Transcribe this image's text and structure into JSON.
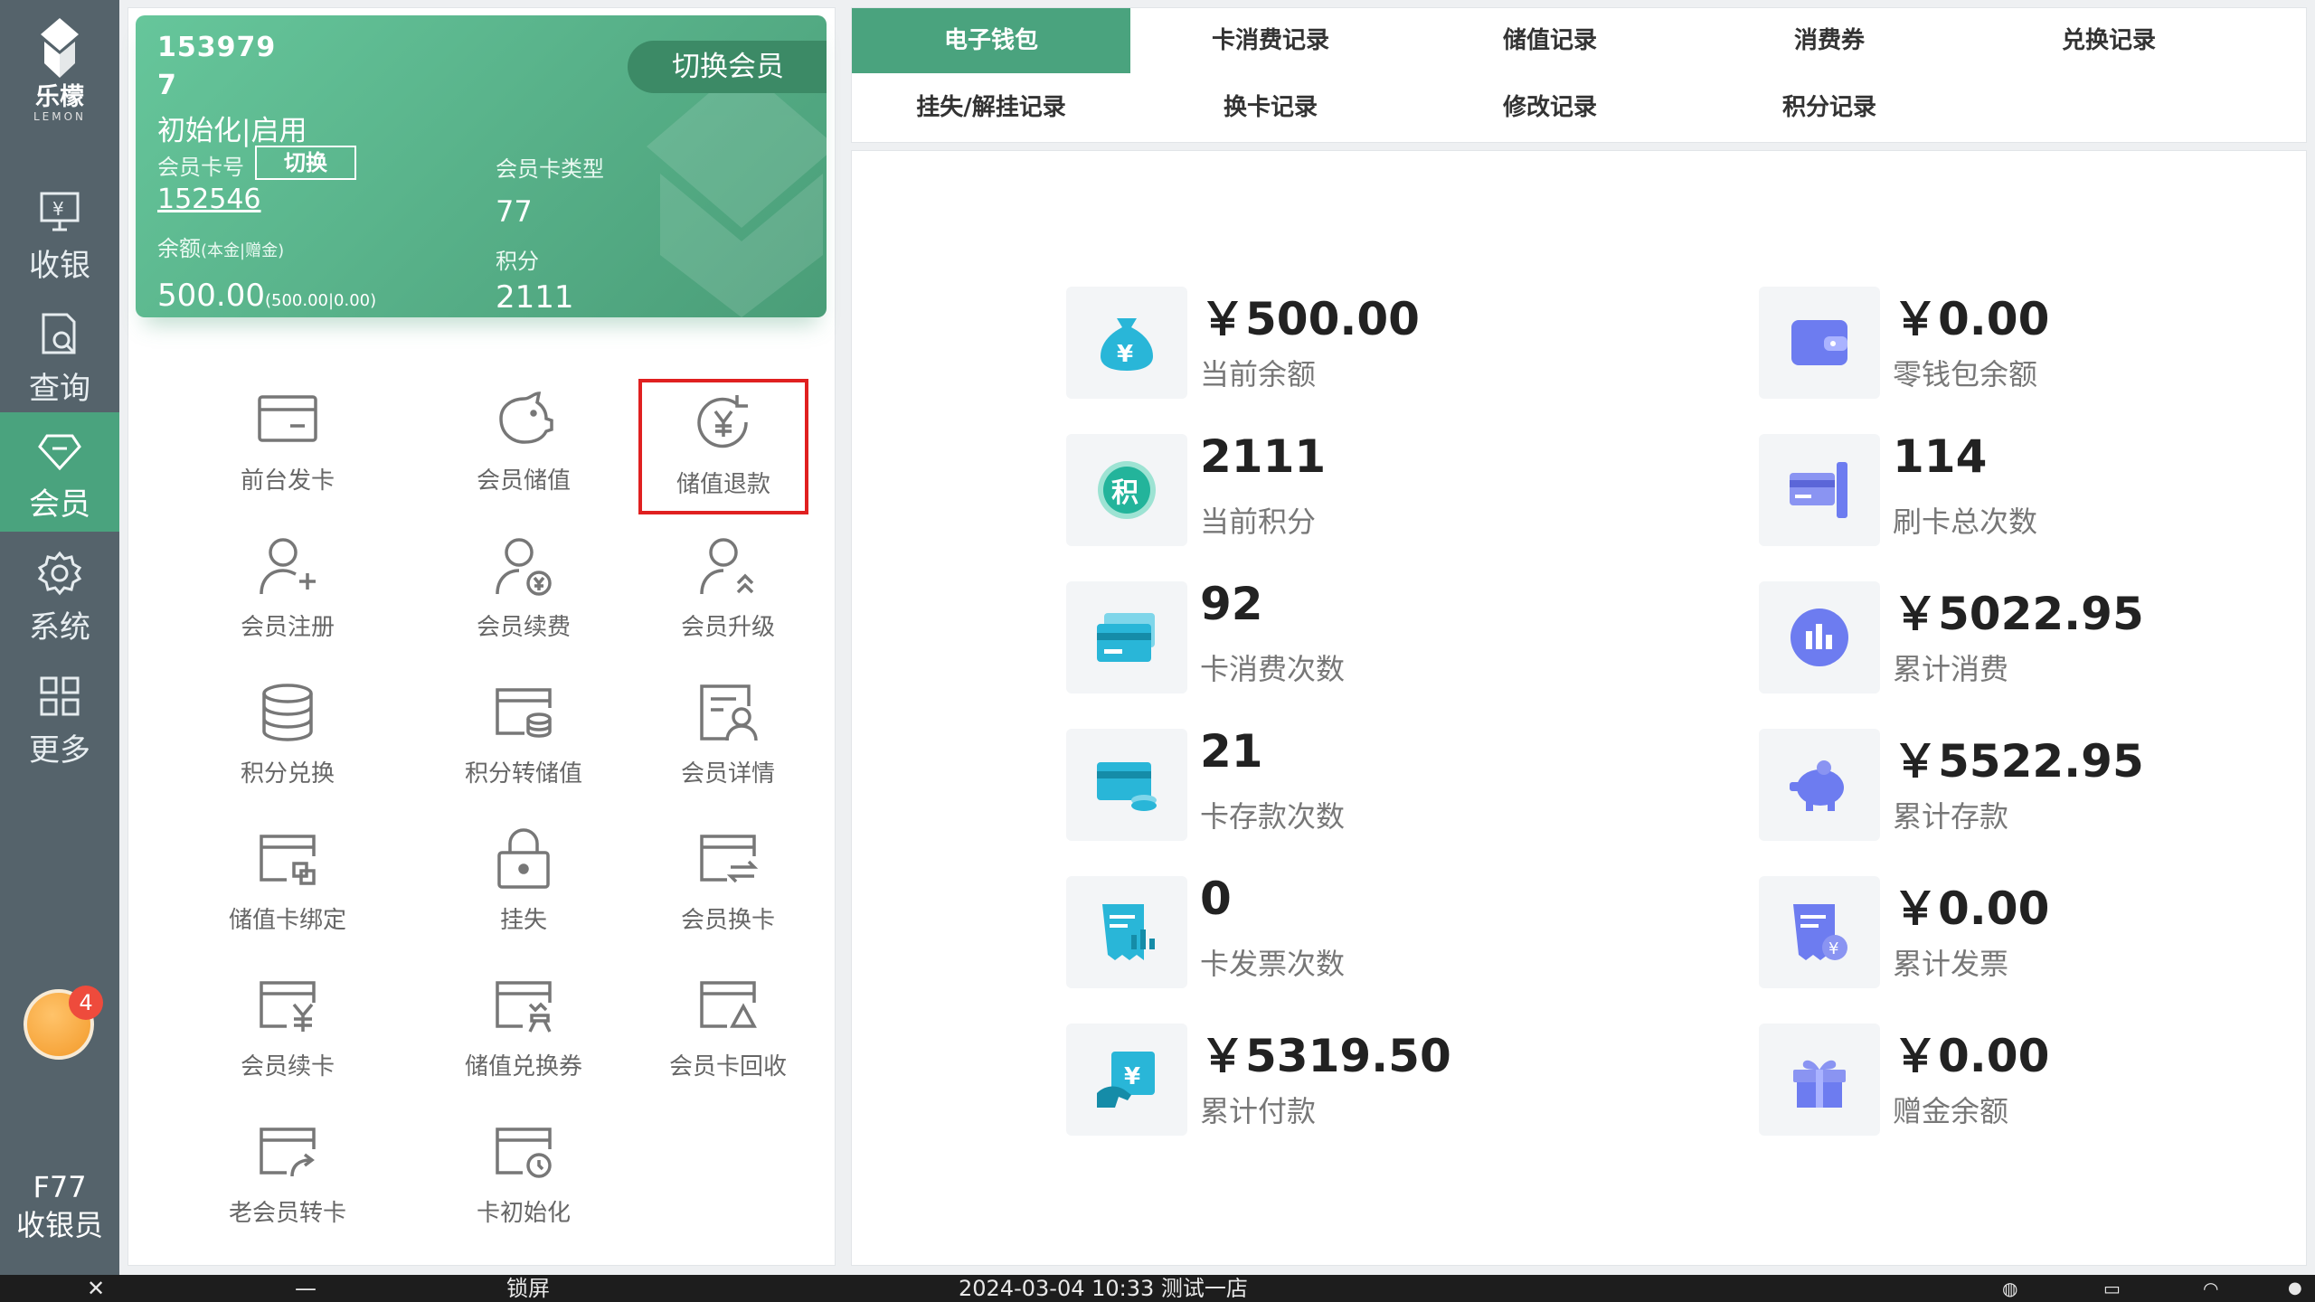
{
  "brand": {
    "name_cn": "乐檬",
    "name_en": "LEMON"
  },
  "nav": {
    "items": [
      {
        "label": "收银",
        "icon": "cashier-icon"
      },
      {
        "label": "查询",
        "icon": "query-icon"
      },
      {
        "label": "会员",
        "icon": "member-diamond-icon",
        "active": true
      },
      {
        "label": "系统",
        "icon": "settings-gear-icon"
      },
      {
        "label": "更多",
        "icon": "grid-more-icon"
      }
    ],
    "notification_count": "4",
    "cashier_code": "F77",
    "cashier_role": "收银员"
  },
  "member_card": {
    "phone_line1": "153979",
    "phone_line2": "7",
    "status": "初始化|启用",
    "card_no_label": "会员卡号",
    "switch_label": "切换",
    "card_no": "152546",
    "balance_label": "余额",
    "balance_label_note": "(本金|赠金)",
    "balance": "500.00",
    "balance_note": "(500.00|0.00)",
    "card_type_label": "会员卡类型",
    "card_type": "77",
    "points_label": "积分",
    "points": "2111",
    "switch_member_label": "切换会员"
  },
  "functions": [
    {
      "label": "前台发卡",
      "icon": "card-icon"
    },
    {
      "label": "会员储值",
      "icon": "piggy-bank-icon"
    },
    {
      "label": "储值退款",
      "icon": "yuan-refund-icon",
      "highlighted": true
    },
    {
      "label": "会员注册",
      "icon": "user-add-icon"
    },
    {
      "label": "会员续费",
      "icon": "user-yuan-icon"
    },
    {
      "label": "会员升级",
      "icon": "user-upgrade-icon"
    },
    {
      "label": "积分兑换",
      "icon": "database-icon"
    },
    {
      "label": "积分转储值",
      "icon": "card-coins-icon"
    },
    {
      "label": "会员详情",
      "icon": "user-detail-icon"
    },
    {
      "label": "储值卡绑定",
      "icon": "card-bind-icon"
    },
    {
      "label": "挂失",
      "icon": "lock-icon"
    },
    {
      "label": "会员换卡",
      "icon": "card-swap-icon"
    },
    {
      "label": "会员续卡",
      "icon": "card-renew-icon"
    },
    {
      "label": "储值兑换券",
      "icon": "card-exchange-icon"
    },
    {
      "label": "会员卡回收",
      "icon": "card-recycle-icon"
    },
    {
      "label": "老会员转卡",
      "icon": "card-transfer-icon"
    },
    {
      "label": "卡初始化",
      "icon": "card-init-icon"
    }
  ],
  "tabs": {
    "row1": [
      "电子钱包",
      "卡消费记录",
      "储值记录",
      "消费券",
      "兑换记录"
    ],
    "row2": [
      "挂失/解挂记录",
      "换卡记录",
      "修改记录",
      "积分记录"
    ],
    "active": "电子钱包"
  },
  "stats": [
    {
      "value": "￥500.00",
      "label": "当前余额",
      "icon": "money-bag-icon"
    },
    {
      "value": "￥0.00",
      "label": "零钱包余额",
      "icon": "wallet-icon"
    },
    {
      "value": "2111",
      "label": "当前积分",
      "icon": "points-icon"
    },
    {
      "value": "114",
      "label": "刷卡总次数",
      "icon": "card-swipe-icon"
    },
    {
      "value": "92",
      "label": "卡消费次数",
      "icon": "cards-icon"
    },
    {
      "value": "￥5022.95",
      "label": "累计消费",
      "icon": "bar-chart-icon"
    },
    {
      "value": "21",
      "label": "卡存款次数",
      "icon": "card-deposit-icon"
    },
    {
      "value": "￥5522.95",
      "label": "累计存款",
      "icon": "piggy-icon"
    },
    {
      "value": "0",
      "label": "卡发票次数",
      "icon": "receipt-icon"
    },
    {
      "value": "￥0.00",
      "label": "累计发票",
      "icon": "invoice-icon"
    },
    {
      "value": "￥5319.50",
      "label": "累计付款",
      "icon": "payment-icon"
    },
    {
      "value": "￥0.00",
      "label": "赠金余额",
      "icon": "gift-icon"
    }
  ],
  "statusbar": {
    "close": "✕",
    "minimize": "—",
    "lock": "锁屏",
    "datetime_store": "2024-03-04 10:33 测试一店"
  },
  "colors": {
    "accent": "#4aa37e",
    "nav_bg": "#55636b",
    "highlight": "#e02020"
  }
}
